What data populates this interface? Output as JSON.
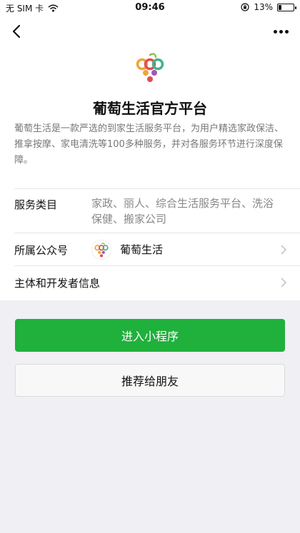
{
  "status": {
    "carrier": "无 SIM 卡",
    "time": "09:46",
    "battery": "13%",
    "battery_level": 0.13
  },
  "nav": {
    "back_icon": "chevron-left-icon",
    "more_icon": "more-dots-icon"
  },
  "app": {
    "name": "葡萄生活官方平台",
    "description": "葡萄生活是一款严选的到家生活服务平台，为用户精选家政保洁、推拿按摩、家电清洗等100多种服务，并对各服务环节进行深度保障。"
  },
  "info": {
    "service_label": "服务类目",
    "service_value": "家政、丽人、综合生活服务平台、洗浴保健、搬家公司",
    "account_label": "所属公众号",
    "account_value": "葡萄生活",
    "developer_label": "主体和开发者信息"
  },
  "actions": {
    "enter": "进入小程序",
    "recommend": "推荐给朋友"
  },
  "colors": {
    "primary": "#20b03c",
    "background": "#efeff4"
  }
}
